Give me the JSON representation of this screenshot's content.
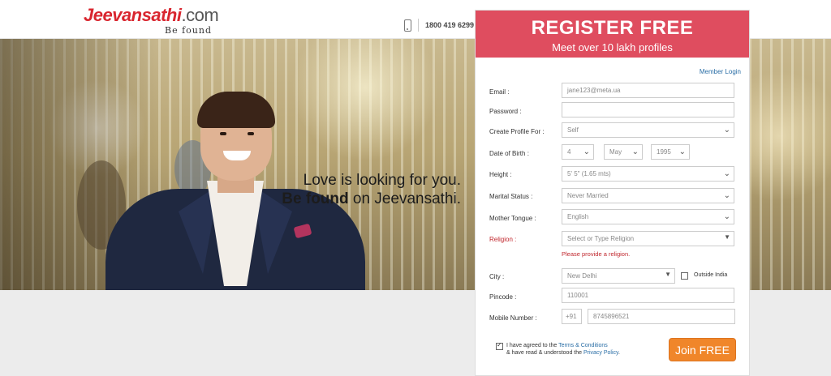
{
  "header": {
    "logo_name": "Jeevansathi",
    "logo_tld": ".com",
    "logo_tagline": "Be found",
    "phone_icon": "phone-icon",
    "phone_number": "1800 419 6299"
  },
  "hero": {
    "tagline_line1": "Love is looking for you.",
    "tagline_bold": "Be found",
    "tagline_rest": " on Jeevansathi."
  },
  "register": {
    "title": "REGISTER FREE",
    "subtitle": "Meet over 10 lakh profiles",
    "member_login": "Member Login",
    "email_label": "Email :",
    "email_value": "jane123@meta.ua",
    "password_label": "Password :",
    "password_value": "",
    "profile_for_label": "Create Profile For :",
    "profile_for_value": "Self",
    "dob_label": "Date of Birth :",
    "dob_day": "4",
    "dob_month": "May",
    "dob_year": "1995",
    "height_label": "Height :",
    "height_value": "5' 5\" (1.65 mts)",
    "marital_label": "Marital Status :",
    "marital_value": "Never Married",
    "tongue_label": "Mother Tongue :",
    "tongue_value": "English",
    "religion_label": "Religion :",
    "religion_placeholder": "Select or Type Religion",
    "religion_error": "Please provide a religion.",
    "city_label": "City :",
    "city_value": "New Delhi",
    "outside_india": "Outside India",
    "pincode_label": "Pincode :",
    "pincode_value": "110001",
    "mobile_label": "Mobile Number :",
    "mobile_code": "+91",
    "mobile_value": "8745896521",
    "terms_pre": "I have agreed to the ",
    "terms_link": "Terms & Conditions",
    "terms_mid": "& have read & understood the ",
    "privacy_link": "Privacy Policy",
    "terms_end": ".",
    "join_label": "Join FREE"
  },
  "colors": {
    "brand_red": "#df4d5f",
    "join_orange": "#f0862a",
    "link_blue": "#2a6ea6",
    "error_red": "#c0272d"
  }
}
